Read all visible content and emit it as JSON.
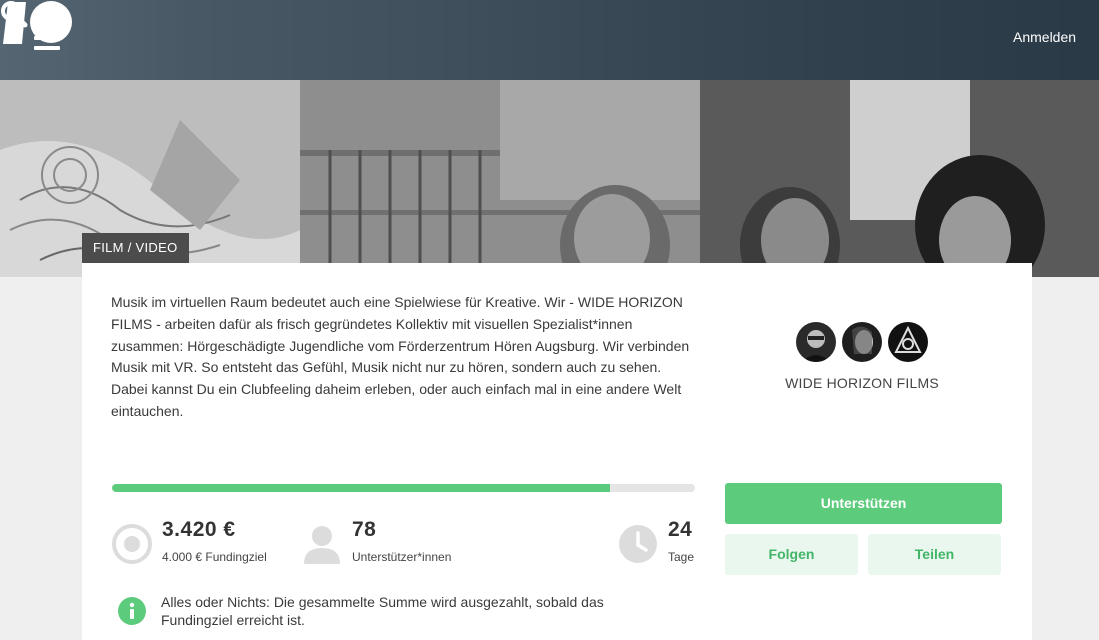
{
  "header": {
    "menu_icon": "hamburger-menu-icon",
    "logo_icon": "startnext-logo-icon",
    "search_icon": "search-icon",
    "login_label": "Anmelden"
  },
  "project": {
    "category": "FILM / VIDEO",
    "description": "Musik im virtuellen Raum bedeutet auch eine Spielwiese für Kreative. Wir - WIDE HORIZON FILMS - arbeiten dafür als frisch gegründetes Kollektiv mit visuellen Spezialist*innen zusammen: Hörgeschädigte Jugendliche vom Förderzentrum Hören Augsburg. Wir verbinden Musik mit VR. So entsteht das Gefühl, Musik nicht nur zu hören, sondern auch zu sehen. Dabei kannst Du ein Clubfeeling daheim erleben, oder auch einfach mal in eine andere Welt eintauchen.",
    "team": {
      "name": "WIDE HORIZON FILMS",
      "avatars": [
        "avatar-1",
        "avatar-2",
        "avatar-3"
      ]
    }
  },
  "funding": {
    "progress": 0.855,
    "amount": "3.420 €",
    "goal_label": "4.000 € Fundingziel",
    "supporters": "78",
    "supporters_label": "Unterstützer*innen",
    "days": "24",
    "days_label": "Tage"
  },
  "actions": {
    "support_label": "Unterstützen",
    "follow_label": "Folgen",
    "share_label": "Teilen"
  },
  "info": {
    "text": "Alles oder Nichts: Die gesammelte Summe wird ausgezahlt, sobald das Fundingziel erreicht ist."
  },
  "colors": {
    "accent": "#5dcb7c",
    "accent_light": "#eaf7ee",
    "navbar": "#283e50",
    "icon_gray": "#dcdcdc"
  }
}
